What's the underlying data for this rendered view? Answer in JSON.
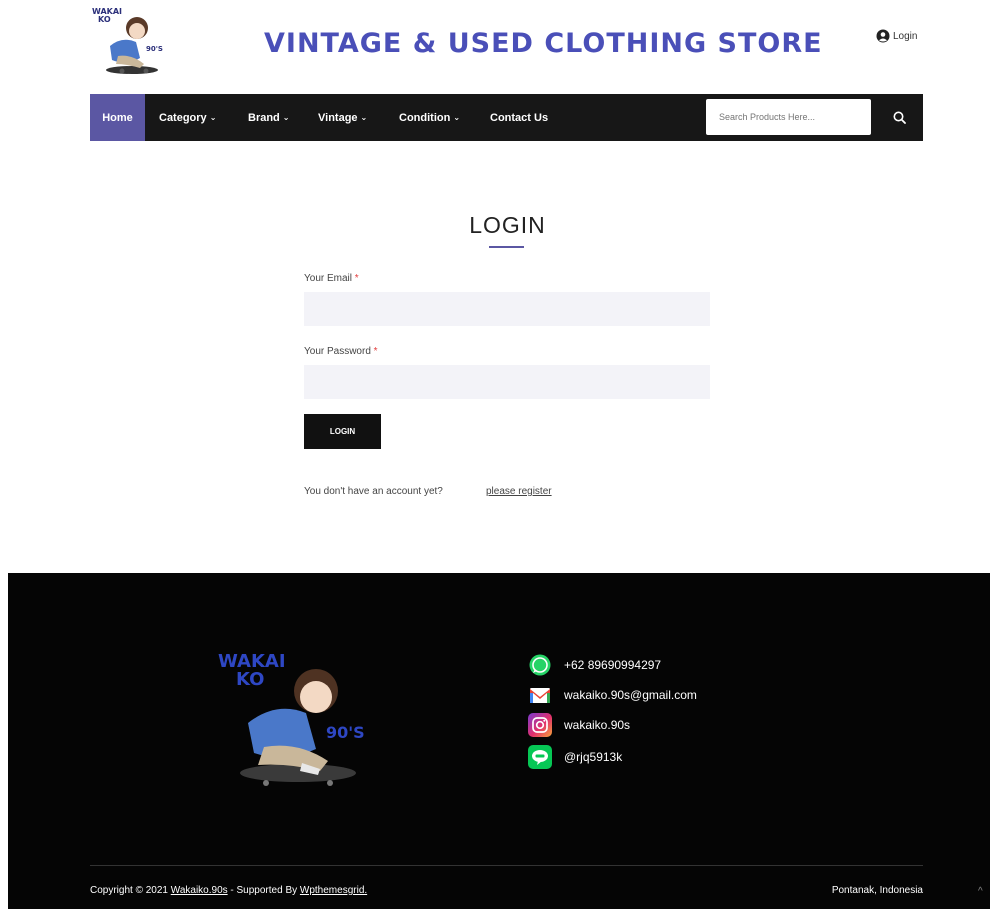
{
  "header": {
    "logo_text_top": "WAKAI",
    "logo_text_mid": "KO",
    "logo_text_90s": "90'S",
    "site_title": "VINTAGE & USED CLOTHING STORE",
    "login_label": "Login"
  },
  "nav": {
    "items": [
      {
        "label": "Home"
      },
      {
        "label": "Category"
      },
      {
        "label": "Brand"
      },
      {
        "label": "Vintage"
      },
      {
        "label": "Condition"
      },
      {
        "label": "Contact Us"
      }
    ],
    "search_placeholder": "Search Products Here...",
    "active_color": "#5b57a3"
  },
  "login_form": {
    "title": "LOGIN",
    "email_label": "Your Email",
    "password_label": "Your Password",
    "required_mark": "*",
    "email_value": "",
    "password_value": "",
    "submit_label": "LOGIN",
    "no_account_text": "You don't have an account yet?",
    "register_link": "please register"
  },
  "footer": {
    "logo_text_top": "WAKAI",
    "logo_text_mid": "KO",
    "logo_text_90s": "90'S",
    "contacts": [
      {
        "icon": "whatsapp-icon",
        "text": "+62 89690994297"
      },
      {
        "icon": "gmail-icon",
        "text": "wakaiko.90s@gmail.com"
      },
      {
        "icon": "instagram-icon",
        "text": "wakaiko.90s"
      },
      {
        "icon": "line-icon",
        "text": "@rjq5913k"
      }
    ],
    "copyright_prefix": "Copyright © 2021",
    "copyright_site": "Wakaiko.90s",
    "copyright_mid": "- Supported By",
    "copyright_supporter": "Wpthemesgrid.",
    "location": "Pontanak, Indonesia",
    "scroll_top": "^"
  }
}
